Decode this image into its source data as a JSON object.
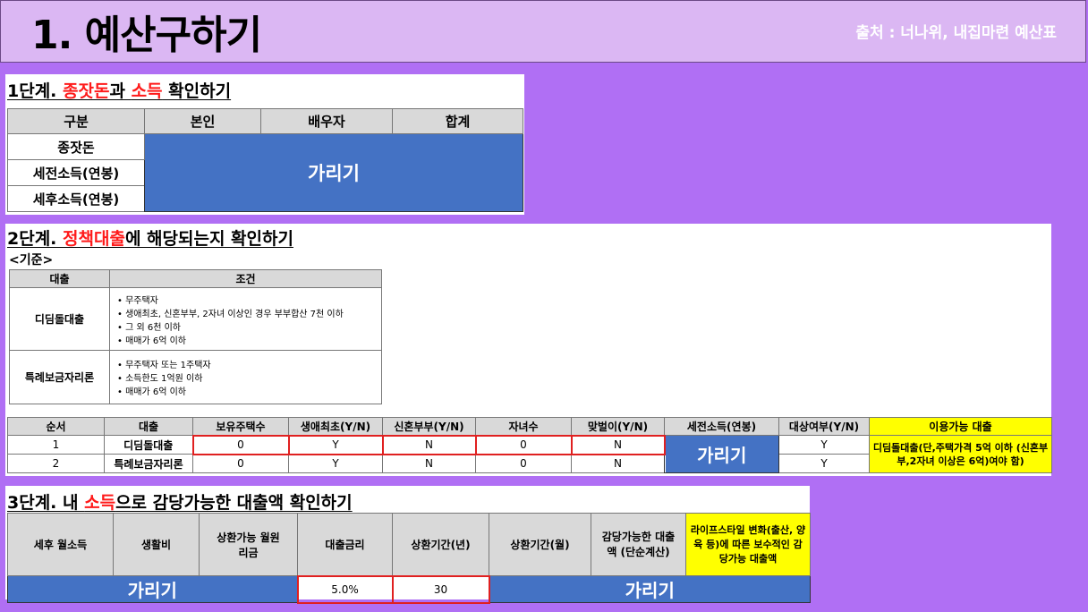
{
  "header": {
    "title": "1. 예산구하기",
    "source": "출처 : 너나위, 내집마련 예산표"
  },
  "step1": {
    "title_pre": "1단계. ",
    "title_red1": "종잣돈",
    "title_mid": "과 ",
    "title_red2": "소득",
    "title_post": " 확인하기",
    "headers": [
      "구분",
      "본인",
      "배우자",
      "합계"
    ],
    "rows": [
      "종잣돈",
      "세전소득(연봉)",
      "세후소득(연봉)"
    ],
    "hidden": "가리기"
  },
  "step2": {
    "title_pre": "2단계. ",
    "title_red": "정책대출",
    "title_post": "에 해당되는지 확인하기",
    "criteria_label": "<기준>",
    "criteria_headers": [
      "대출",
      "조건"
    ],
    "criteria": [
      {
        "name": "디딤돌대출",
        "conditions": [
          "무주택자",
          "생애최초, 신혼부부, 2자녀 이상인 경우 부부합산 7천 이하",
          "그 외 6천 이하",
          "매매가 6억 이하"
        ]
      },
      {
        "name": "특례보금자리론",
        "conditions": [
          "무주택자 또는 1주택자",
          "소득한도 1억원 이하",
          "매매가 6억 이하"
        ]
      }
    ],
    "check_headers": [
      "순서",
      "대출",
      "보유주택수",
      "생애최초(Y/N)",
      "신혼부부(Y/N)",
      "자녀수",
      "맞벌이(Y/N)",
      "세전소득(연봉)",
      "대상여부(Y/N)",
      "이용가능 대출"
    ],
    "check_rows": [
      {
        "no": "1",
        "loan": "디딤돌대출",
        "houses": "0",
        "first": "Y",
        "newlywed": "N",
        "children": "0",
        "dual": "N",
        "target": "Y"
      },
      {
        "no": "2",
        "loan": "특례보금자리론",
        "houses": "0",
        "first": "Y",
        "newlywed": "N",
        "children": "0",
        "dual": "N",
        "target": "Y"
      }
    ],
    "hidden": "가리기",
    "available": "디딤돌대출(단,주택가격 5억 이하 (신혼부부,2자녀 이상은 6억)여야 함)"
  },
  "step3": {
    "title_pre": "3단계. 내 ",
    "title_red": "소득",
    "title_post": "으로 감당가능한 대출액 확인하기",
    "headers": [
      "세후 월소득",
      "생활비",
      "상환가능 월원리금",
      "대출금리",
      "상환기간(년)",
      "상환기간(월)",
      "감당가능한 대출액 (단순계산)",
      "라이프스타일 변화(출산, 양육 등)에 따른 보수적인 감당가능 대출액"
    ],
    "hidden_left": "가리기",
    "rate": "5.0%",
    "years": "30",
    "hidden_right": "가리기"
  },
  "colors": {
    "background": "#b06ff4",
    "header": "#dbb7f3",
    "blue_cell": "#4472c4",
    "yellow_cell": "#ffff00",
    "red_text": "#ff1a1a"
  }
}
